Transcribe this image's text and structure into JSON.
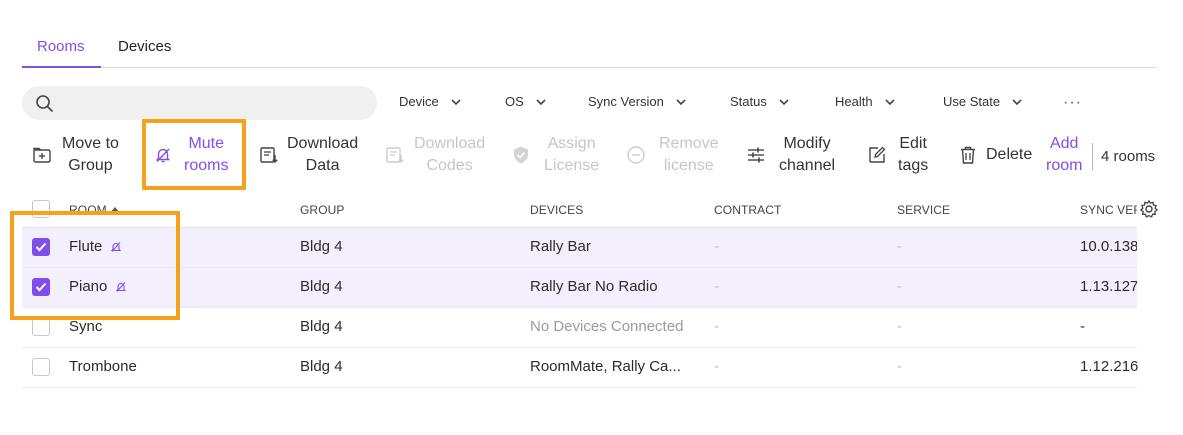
{
  "tabs": {
    "rooms": "Rooms",
    "devices": "Devices"
  },
  "filters": {
    "device": "Device",
    "os": "OS",
    "sync_version": "Sync Version",
    "status": "Status",
    "health": "Health",
    "use_state": "Use State",
    "more": "···"
  },
  "toolbar": {
    "move_to_group": [
      "Move to",
      "Group"
    ],
    "mute_rooms": [
      "Mute",
      "rooms"
    ],
    "download_data": [
      "Download",
      "Data"
    ],
    "download_codes": [
      "Download",
      "Codes"
    ],
    "assign_license": [
      "Assign",
      "License"
    ],
    "remove_license": [
      "Remove",
      "license"
    ],
    "modify_channel": [
      "Modify",
      "channel"
    ],
    "edit_tags": [
      "Edit",
      "tags"
    ],
    "delete": "Delete",
    "add_room": [
      "Add",
      "room"
    ],
    "room_count": "4 rooms"
  },
  "table": {
    "headers": {
      "room": "ROOM",
      "group": "GROUP",
      "devices": "DEVICES",
      "contract": "CONTRACT",
      "service": "SERVICE",
      "sync_version": "SYNC VER"
    },
    "rows": [
      {
        "room": "Flute",
        "group": "Bldg 4",
        "devices": "Rally Bar",
        "contract": "-",
        "service": "-",
        "sync": "10.0.138",
        "checked": true,
        "muted": true
      },
      {
        "room": "Piano",
        "group": "Bldg 4",
        "devices": "Rally Bar No Radio",
        "contract": "-",
        "service": "-",
        "sync": "1.13.127",
        "checked": true,
        "muted": true
      },
      {
        "room": "Sync",
        "group": "Bldg 4",
        "devices": "No Devices Connected",
        "contract": "-",
        "service": "-",
        "sync": "-",
        "checked": false,
        "muted": false
      },
      {
        "room": "Trombone",
        "group": "Bldg 4",
        "devices": "RoomMate, Rally Ca...",
        "contract": "-",
        "service": "-",
        "sync": "1.12.216",
        "checked": false,
        "muted": false
      }
    ]
  },
  "colors": {
    "accent": "#814eee",
    "highlight": "#f5a11c",
    "selected_row": "#f4effd"
  }
}
